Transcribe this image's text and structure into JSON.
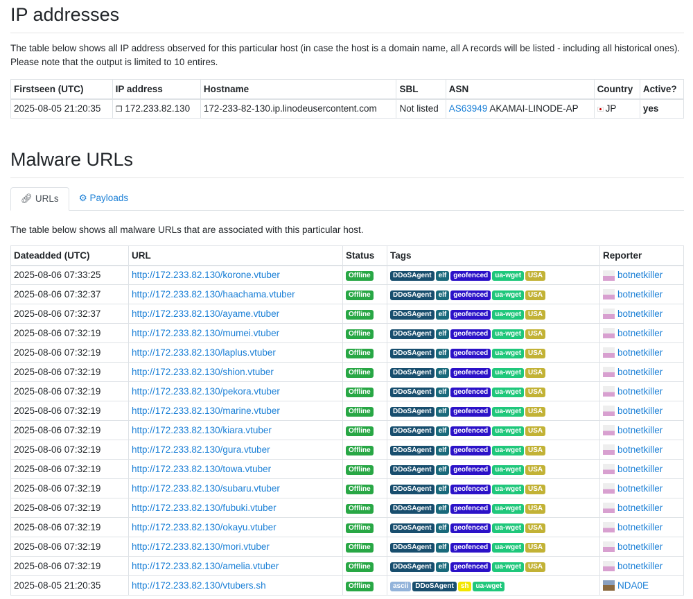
{
  "ip_section": {
    "title": "IP addresses",
    "description": "The table below shows all IP address observed for this particular host (in case the host is a domain name, all A records will be listed - including all historical ones). Please note that the output is limited to 10 entires.",
    "headers": [
      "Firstseen (UTC)",
      "IP address",
      "Hostname",
      "SBL",
      "ASN",
      "Country",
      "Active?"
    ],
    "row": {
      "firstseen": "2025-08-05 21:20:35",
      "ip": "172.233.82.130",
      "hostname": "172-233-82-130.ip.linodeusercontent.com",
      "sbl": "Not listed",
      "asn_link": "AS63949",
      "asn_name": "AKAMAI-LINODE-AP",
      "country": "JP",
      "active": "yes"
    }
  },
  "malware_section": {
    "title": "Malware URLs",
    "tabs": [
      {
        "label": "URLs",
        "icon": "link-icon"
      },
      {
        "label": "Payloads",
        "icon": "gear-icon"
      }
    ],
    "description": "The table below shows all malware URLs that are associated with this particular host.",
    "headers": [
      "Dateadded (UTC)",
      "URL",
      "Status",
      "Tags",
      "Reporter"
    ],
    "tag_colors": {
      "DDoSAgent": "#184e6e",
      "elf": "#19697b",
      "geofenced": "#2b12c8",
      "ua-wget": "#1fc77b",
      "USA": "#c2b236",
      "ascii": "#93b3da",
      "sh": "#f2e600"
    },
    "status_color": "#28a745",
    "rows": [
      {
        "date": "2025-08-06 07:33:25",
        "url": "http://172.233.82.130/korone.vtuber",
        "status": "Offline",
        "tags": [
          "DDoSAgent",
          "elf",
          "geofenced",
          "ua-wget",
          "USA"
        ],
        "reporter": "botnetkiller"
      },
      {
        "date": "2025-08-06 07:32:37",
        "url": "http://172.233.82.130/haachama.vtuber",
        "status": "Offline",
        "tags": [
          "DDoSAgent",
          "elf",
          "geofenced",
          "ua-wget",
          "USA"
        ],
        "reporter": "botnetkiller"
      },
      {
        "date": "2025-08-06 07:32:37",
        "url": "http://172.233.82.130/ayame.vtuber",
        "status": "Offline",
        "tags": [
          "DDoSAgent",
          "elf",
          "geofenced",
          "ua-wget",
          "USA"
        ],
        "reporter": "botnetkiller"
      },
      {
        "date": "2025-08-06 07:32:19",
        "url": "http://172.233.82.130/mumei.vtuber",
        "status": "Offline",
        "tags": [
          "DDoSAgent",
          "elf",
          "geofenced",
          "ua-wget",
          "USA"
        ],
        "reporter": "botnetkiller"
      },
      {
        "date": "2025-08-06 07:32:19",
        "url": "http://172.233.82.130/laplus.vtuber",
        "status": "Offline",
        "tags": [
          "DDoSAgent",
          "elf",
          "geofenced",
          "ua-wget",
          "USA"
        ],
        "reporter": "botnetkiller"
      },
      {
        "date": "2025-08-06 07:32:19",
        "url": "http://172.233.82.130/shion.vtuber",
        "status": "Offline",
        "tags": [
          "DDoSAgent",
          "elf",
          "geofenced",
          "ua-wget",
          "USA"
        ],
        "reporter": "botnetkiller"
      },
      {
        "date": "2025-08-06 07:32:19",
        "url": "http://172.233.82.130/pekora.vtuber",
        "status": "Offline",
        "tags": [
          "DDoSAgent",
          "elf",
          "geofenced",
          "ua-wget",
          "USA"
        ],
        "reporter": "botnetkiller"
      },
      {
        "date": "2025-08-06 07:32:19",
        "url": "http://172.233.82.130/marine.vtuber",
        "status": "Offline",
        "tags": [
          "DDoSAgent",
          "elf",
          "geofenced",
          "ua-wget",
          "USA"
        ],
        "reporter": "botnetkiller"
      },
      {
        "date": "2025-08-06 07:32:19",
        "url": "http://172.233.82.130/kiara.vtuber",
        "status": "Offline",
        "tags": [
          "DDoSAgent",
          "elf",
          "geofenced",
          "ua-wget",
          "USA"
        ],
        "reporter": "botnetkiller"
      },
      {
        "date": "2025-08-06 07:32:19",
        "url": "http://172.233.82.130/gura.vtuber",
        "status": "Offline",
        "tags": [
          "DDoSAgent",
          "elf",
          "geofenced",
          "ua-wget",
          "USA"
        ],
        "reporter": "botnetkiller"
      },
      {
        "date": "2025-08-06 07:32:19",
        "url": "http://172.233.82.130/towa.vtuber",
        "status": "Offline",
        "tags": [
          "DDoSAgent",
          "elf",
          "geofenced",
          "ua-wget",
          "USA"
        ],
        "reporter": "botnetkiller"
      },
      {
        "date": "2025-08-06 07:32:19",
        "url": "http://172.233.82.130/subaru.vtuber",
        "status": "Offline",
        "tags": [
          "DDoSAgent",
          "elf",
          "geofenced",
          "ua-wget",
          "USA"
        ],
        "reporter": "botnetkiller"
      },
      {
        "date": "2025-08-06 07:32:19",
        "url": "http://172.233.82.130/fubuki.vtuber",
        "status": "Offline",
        "tags": [
          "DDoSAgent",
          "elf",
          "geofenced",
          "ua-wget",
          "USA"
        ],
        "reporter": "botnetkiller"
      },
      {
        "date": "2025-08-06 07:32:19",
        "url": "http://172.233.82.130/okayu.vtuber",
        "status": "Offline",
        "tags": [
          "DDoSAgent",
          "elf",
          "geofenced",
          "ua-wget",
          "USA"
        ],
        "reporter": "botnetkiller"
      },
      {
        "date": "2025-08-06 07:32:19",
        "url": "http://172.233.82.130/mori.vtuber",
        "status": "Offline",
        "tags": [
          "DDoSAgent",
          "elf",
          "geofenced",
          "ua-wget",
          "USA"
        ],
        "reporter": "botnetkiller"
      },
      {
        "date": "2025-08-06 07:32:19",
        "url": "http://172.233.82.130/amelia.vtuber",
        "status": "Offline",
        "tags": [
          "DDoSAgent",
          "elf",
          "geofenced",
          "ua-wget",
          "USA"
        ],
        "reporter": "botnetkiller"
      },
      {
        "date": "2025-08-05 21:20:35",
        "url": "http://172.233.82.130/vtubers.sh",
        "status": "Offline",
        "tags": [
          "ascii",
          "DDoSAgent",
          "sh",
          "ua-wget"
        ],
        "reporter": "NDA0E",
        "avatar": "photo"
      }
    ]
  }
}
